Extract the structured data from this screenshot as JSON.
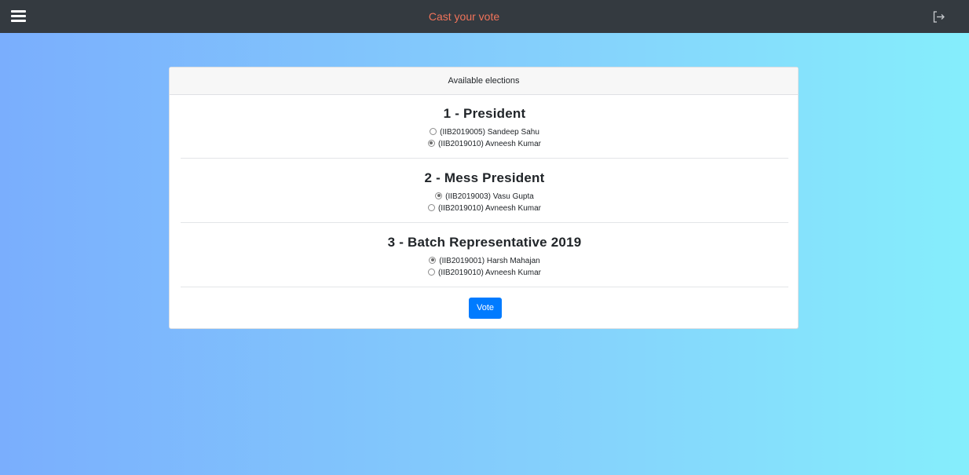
{
  "navbar": {
    "title": "Cast your vote",
    "menu_icon": "hamburger-menu-icon",
    "logout_icon": "logout-icon",
    "background": "#343a40",
    "title_color": "#f0735a"
  },
  "card": {
    "header": "Available elections",
    "elections": [
      {
        "title": "1 - President",
        "candidates": [
          {
            "label": "(IIB2019005) Sandeep Sahu",
            "selected": false
          },
          {
            "label": "(IIB2019010) Avneesh Kumar",
            "selected": true
          }
        ]
      },
      {
        "title": "2 - Mess President",
        "candidates": [
          {
            "label": "(IIB2019003) Vasu Gupta",
            "selected": true
          },
          {
            "label": "(IIB2019010) Avneesh Kumar",
            "selected": false
          }
        ]
      },
      {
        "title": "3 - Batch Representative 2019",
        "candidates": [
          {
            "label": "(IIB2019001) Harsh Mahajan",
            "selected": true
          },
          {
            "label": "(IIB2019010) Avneesh Kumar",
            "selected": false
          }
        ]
      }
    ],
    "vote_button": "Vote",
    "accent_color": "#007bff"
  }
}
